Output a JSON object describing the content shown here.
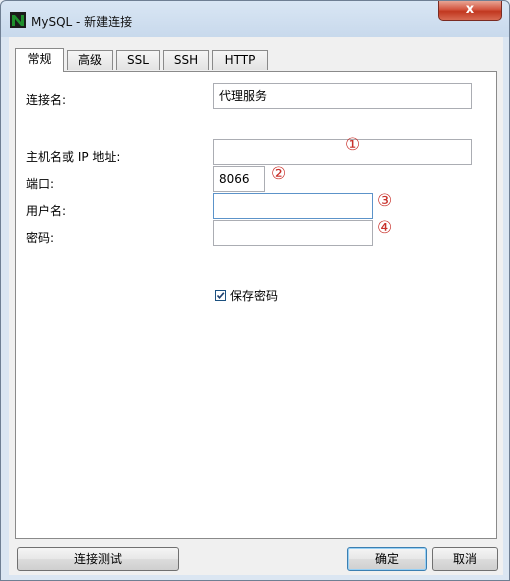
{
  "window": {
    "title": "MySQL - 新建连接",
    "close_glyph": "x"
  },
  "tabs": [
    {
      "label": "常规",
      "active": true
    },
    {
      "label": "高级",
      "active": false
    },
    {
      "label": "SSL",
      "active": false
    },
    {
      "label": "SSH",
      "active": false
    },
    {
      "label": "HTTP",
      "active": false
    }
  ],
  "form": {
    "connection_name": {
      "label": "连接名:",
      "value": "代理服务"
    },
    "host": {
      "label": "主机名或 IP 地址:",
      "value": "",
      "marker": "①"
    },
    "port": {
      "label": "端口:",
      "value": "8066",
      "marker": "②"
    },
    "username": {
      "label": "用户名:",
      "value": "",
      "marker": "③"
    },
    "password": {
      "label": "密码:",
      "value": "",
      "marker": "④"
    },
    "save_password": {
      "label": "保存密码",
      "checked": true
    }
  },
  "buttons": {
    "test": "连接测试",
    "ok": "确定",
    "cancel": "取消"
  },
  "colors": {
    "marker": "#c8302a",
    "focus_border": "#5c93c9",
    "icon_green": "#1f8f2d"
  },
  "icons": {
    "app": "navicat-logo-icon",
    "close": "close-icon",
    "check": "checkmark-icon"
  }
}
